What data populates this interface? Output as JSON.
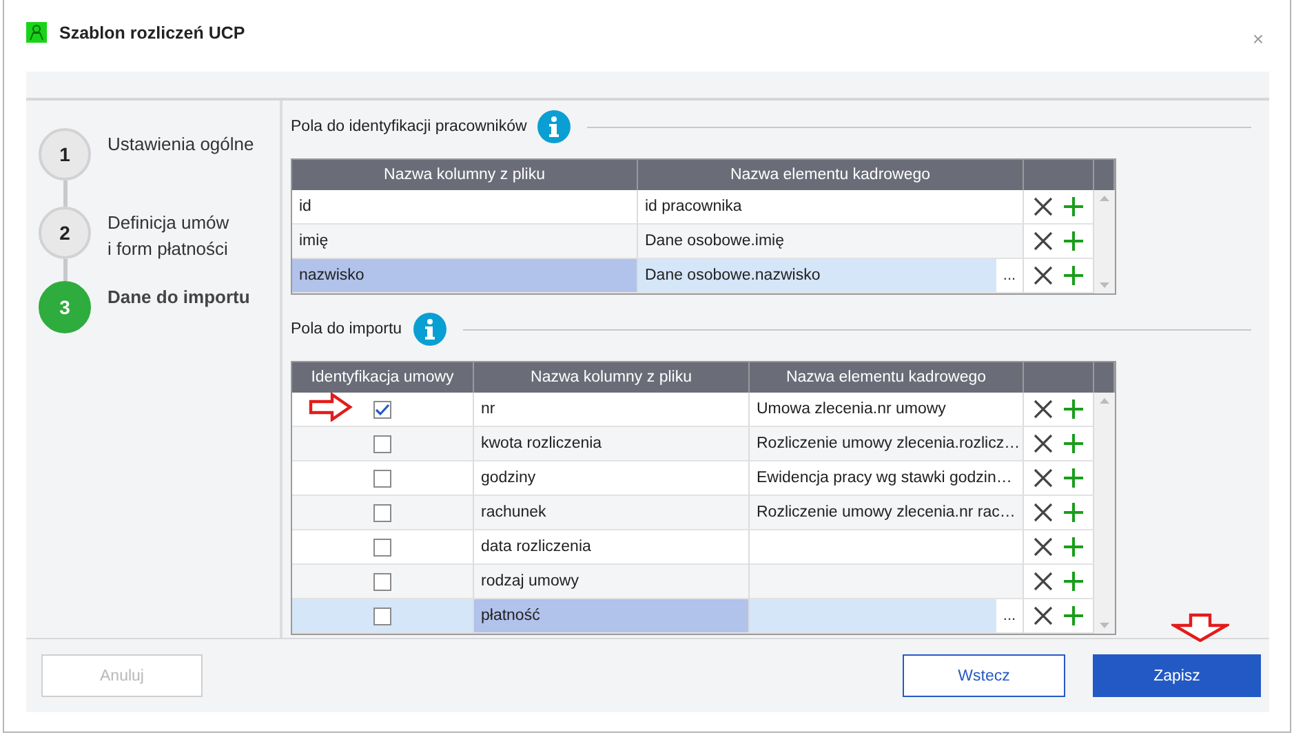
{
  "window": {
    "title": "Szablon rozliczeń UCP",
    "close": "×"
  },
  "steps": [
    {
      "number": "1",
      "label": "Ustawienia ogólne",
      "selected": false
    },
    {
      "number": "2",
      "label": "Definicja umów\ni form płatności",
      "selected": false
    },
    {
      "number": "3",
      "label": "Dane do importu",
      "selected": true
    }
  ],
  "employee_fields": {
    "title": "Pola do identyfikacji pracowników",
    "columns": [
      "Nazwa kolumny z pliku",
      "Nazwa elementu kadrowego"
    ],
    "rows": [
      {
        "file_column": "id",
        "element": "id pracownika",
        "selected": false
      },
      {
        "file_column": "imię",
        "element": "Dane osobowe.imię",
        "selected": false
      },
      {
        "file_column": "nazwisko",
        "element": "Dane osobowe.nazwisko",
        "selected": true,
        "browse": "..."
      }
    ]
  },
  "import_fields": {
    "title": "Pola do importu",
    "columns": [
      "Identyfikacja umowy",
      "Nazwa kolumny z pliku",
      "Nazwa elementu kadrowego"
    ],
    "rows": [
      {
        "checked": true,
        "file_column": "nr",
        "element": "Umowa zlecenia.nr umowy",
        "selected": false
      },
      {
        "checked": false,
        "file_column": "kwota rozliczenia",
        "element": "Rozliczenie umowy zlecenia.rozlicz…",
        "selected": false
      },
      {
        "checked": false,
        "file_column": "godziny",
        "element": "Ewidencja pracy wg stawki godzin…",
        "selected": false
      },
      {
        "checked": false,
        "file_column": "rachunek",
        "element": "Rozliczenie umowy zlecenia.nr rac…",
        "selected": false
      },
      {
        "checked": false,
        "file_column": "data rozliczenia",
        "selected": false
      },
      {
        "checked": false,
        "file_column": "rodzaj umowy",
        "selected": false
      },
      {
        "checked": false,
        "file_column": "płatność",
        "selected": true,
        "browse": "..."
      }
    ]
  },
  "buttons": [
    {
      "label": "Anuluj",
      "kind": "secondary",
      "disabled": true
    },
    {
      "label": "Wstecz",
      "kind": "outline",
      "disabled": false
    },
    {
      "label": "Zapisz",
      "kind": "primary",
      "disabled": false
    }
  ]
}
